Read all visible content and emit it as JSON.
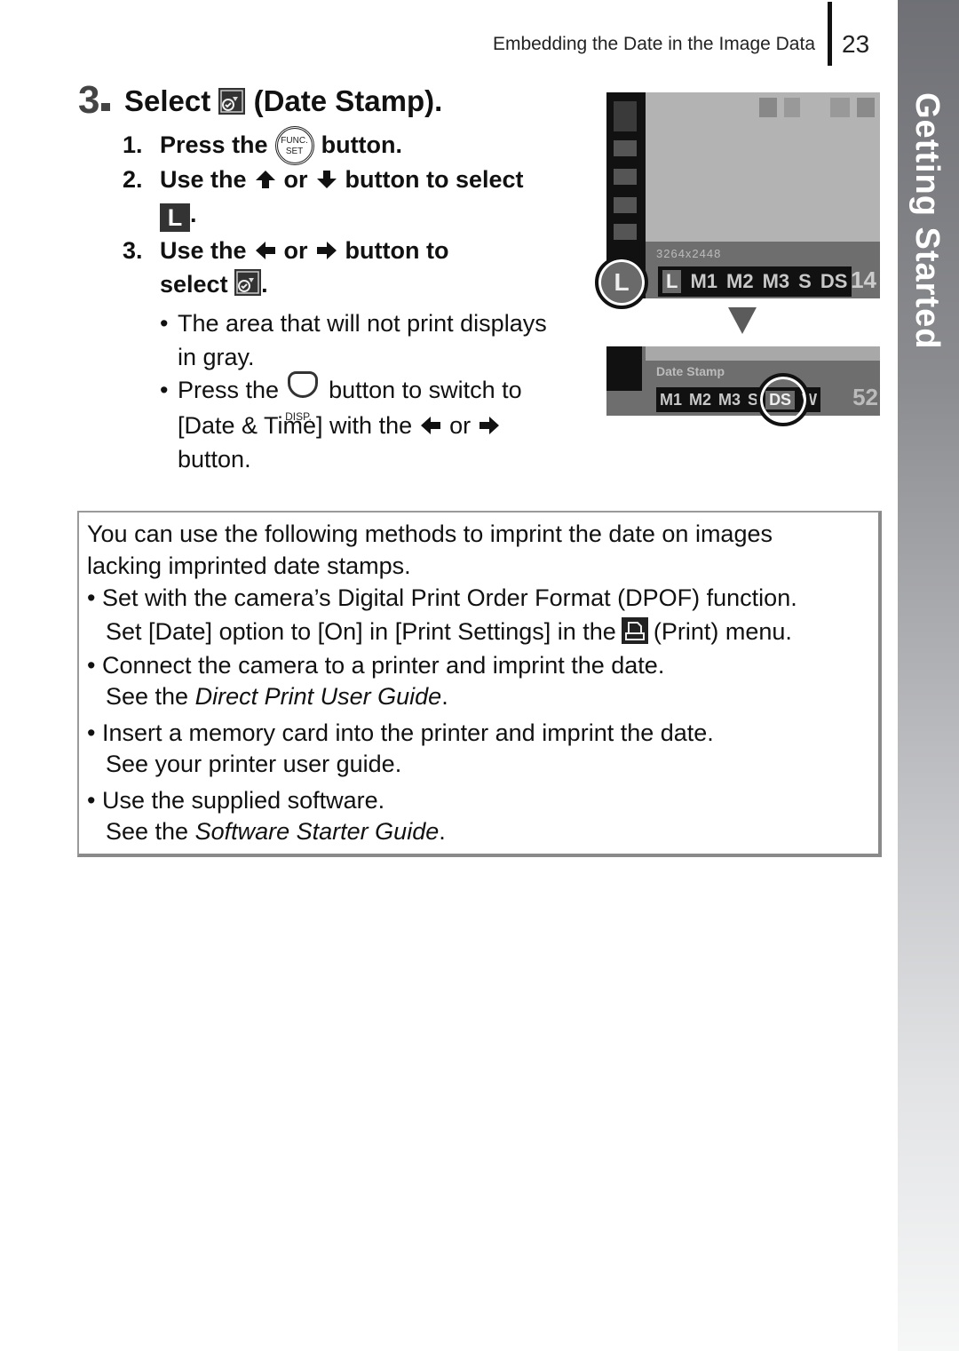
{
  "header": {
    "running_title": "Embedding the Date in the Image Data",
    "page_number": "23"
  },
  "side_tab": {
    "label": "Getting Started"
  },
  "step": {
    "number": "3",
    "title_prefix": "Select",
    "title_icon": "date-stamp-icon",
    "title_suffix": "(Date Stamp)."
  },
  "substeps": [
    {
      "n": "1.",
      "before": "Press the",
      "icon": "func-set-button-icon",
      "icon_label_top": "FUNC.",
      "icon_label_bottom": "SET",
      "after": "button."
    },
    {
      "n": "2.",
      "before": "Use the",
      "icon1": "up-arrow-icon",
      "mid": "or",
      "icon2": "down-arrow-icon",
      "after": "button to select",
      "line2_icon": "L",
      "line2_after": "."
    },
    {
      "n": "3.",
      "before": "Use the",
      "icon1": "left-arrow-icon",
      "mid": "or",
      "icon2": "right-arrow-icon",
      "after": "button to",
      "line2_before": "select",
      "line2_icon": "date-stamp-icon",
      "line2_after": "."
    }
  ],
  "bullets": [
    {
      "line1": "The area that will not print displays",
      "line2": "in gray."
    },
    {
      "line1_before": "Press the",
      "disp_label": "DISP.",
      "line1_after": "button to switch to",
      "line2_before": "[Date & Time] with the",
      "line2_mid": "or",
      "line3": "button."
    }
  ],
  "camera_screen_1": {
    "size_text": "3264x2448",
    "options": [
      "L",
      "M1",
      "M2",
      "M3",
      "S",
      "DS"
    ],
    "selected_option": "L",
    "shots_remaining": "14"
  },
  "camera_screen_2": {
    "mode_text": "Date Stamp",
    "options": [
      "M1",
      "M2",
      "M3",
      "S",
      "DS",
      "W"
    ],
    "selected_option": "DS",
    "shots_remaining": "52"
  },
  "info_box": {
    "intro_line1": "You can use the following methods to imprint the date on images",
    "intro_line2": "lacking imprinted date stamps.",
    "items": [
      {
        "line1": "Set with the camera’s Digital Print Order Format (DPOF) function.",
        "line2_before": "Set [Date] option to [On] in [Print Settings] in the",
        "line2_after": "(Print) menu."
      },
      {
        "line1": "Connect the camera to a printer and imprint the date.",
        "line2_before": "See the",
        "line2_italic": "Direct Print User Guide",
        "line2_after": "."
      },
      {
        "line1": "Insert a memory card into the printer and imprint the date.",
        "line2": "See your printer user guide."
      },
      {
        "line1": "Use the supplied software.",
        "line2_before": "See the",
        "line2_italic": "Software Starter Guide",
        "line2_after": "."
      }
    ]
  }
}
